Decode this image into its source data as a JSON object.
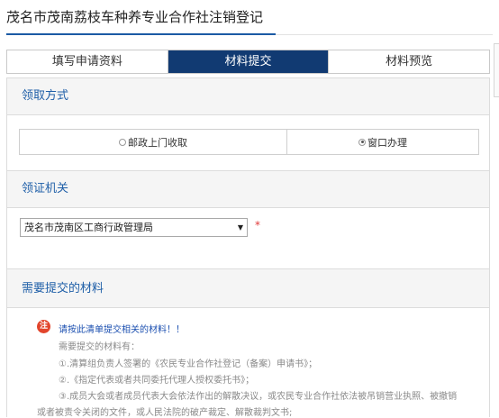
{
  "page": {
    "title": "茂名市茂南荔枝车种养专业合作社注销登记"
  },
  "tabs": [
    {
      "label": "填写申请资料",
      "active": false
    },
    {
      "label": "材料提交",
      "active": true
    },
    {
      "label": "材料预览",
      "active": false
    }
  ],
  "pickup": {
    "heading": "领取方式",
    "options": [
      {
        "label": "邮政上门收取",
        "checked": false
      },
      {
        "label": "窗口办理",
        "checked": true
      }
    ]
  },
  "authority": {
    "heading": "领证机关",
    "selected": "茂名市茂南区工商行政管理局",
    "required_mark": "*"
  },
  "materials": {
    "heading": "需要提交的材料",
    "badge": "注",
    "notice": "请按此清单提交相关的材料！！",
    "intro": "需要提交的材料有：",
    "items": [
      "①.清算组负责人签署的《农民专业合作社登记（备案）申请书》；",
      "②.《指定代表或者共同委托代理人授权委托书》；",
      "③.成员大会或者成员代表大会依法作出的解散决议，或农民专业合作社依法被吊销营业执照、被撤销"
    ],
    "continuation": "或者被责令关闭的文件，或人民法院的破产裁定、解散裁判文书;"
  },
  "colors": {
    "active_tab": "#113a72",
    "section_heading": "#1f5fa8",
    "badge": "#e2452c",
    "required": "#e03a3a"
  }
}
